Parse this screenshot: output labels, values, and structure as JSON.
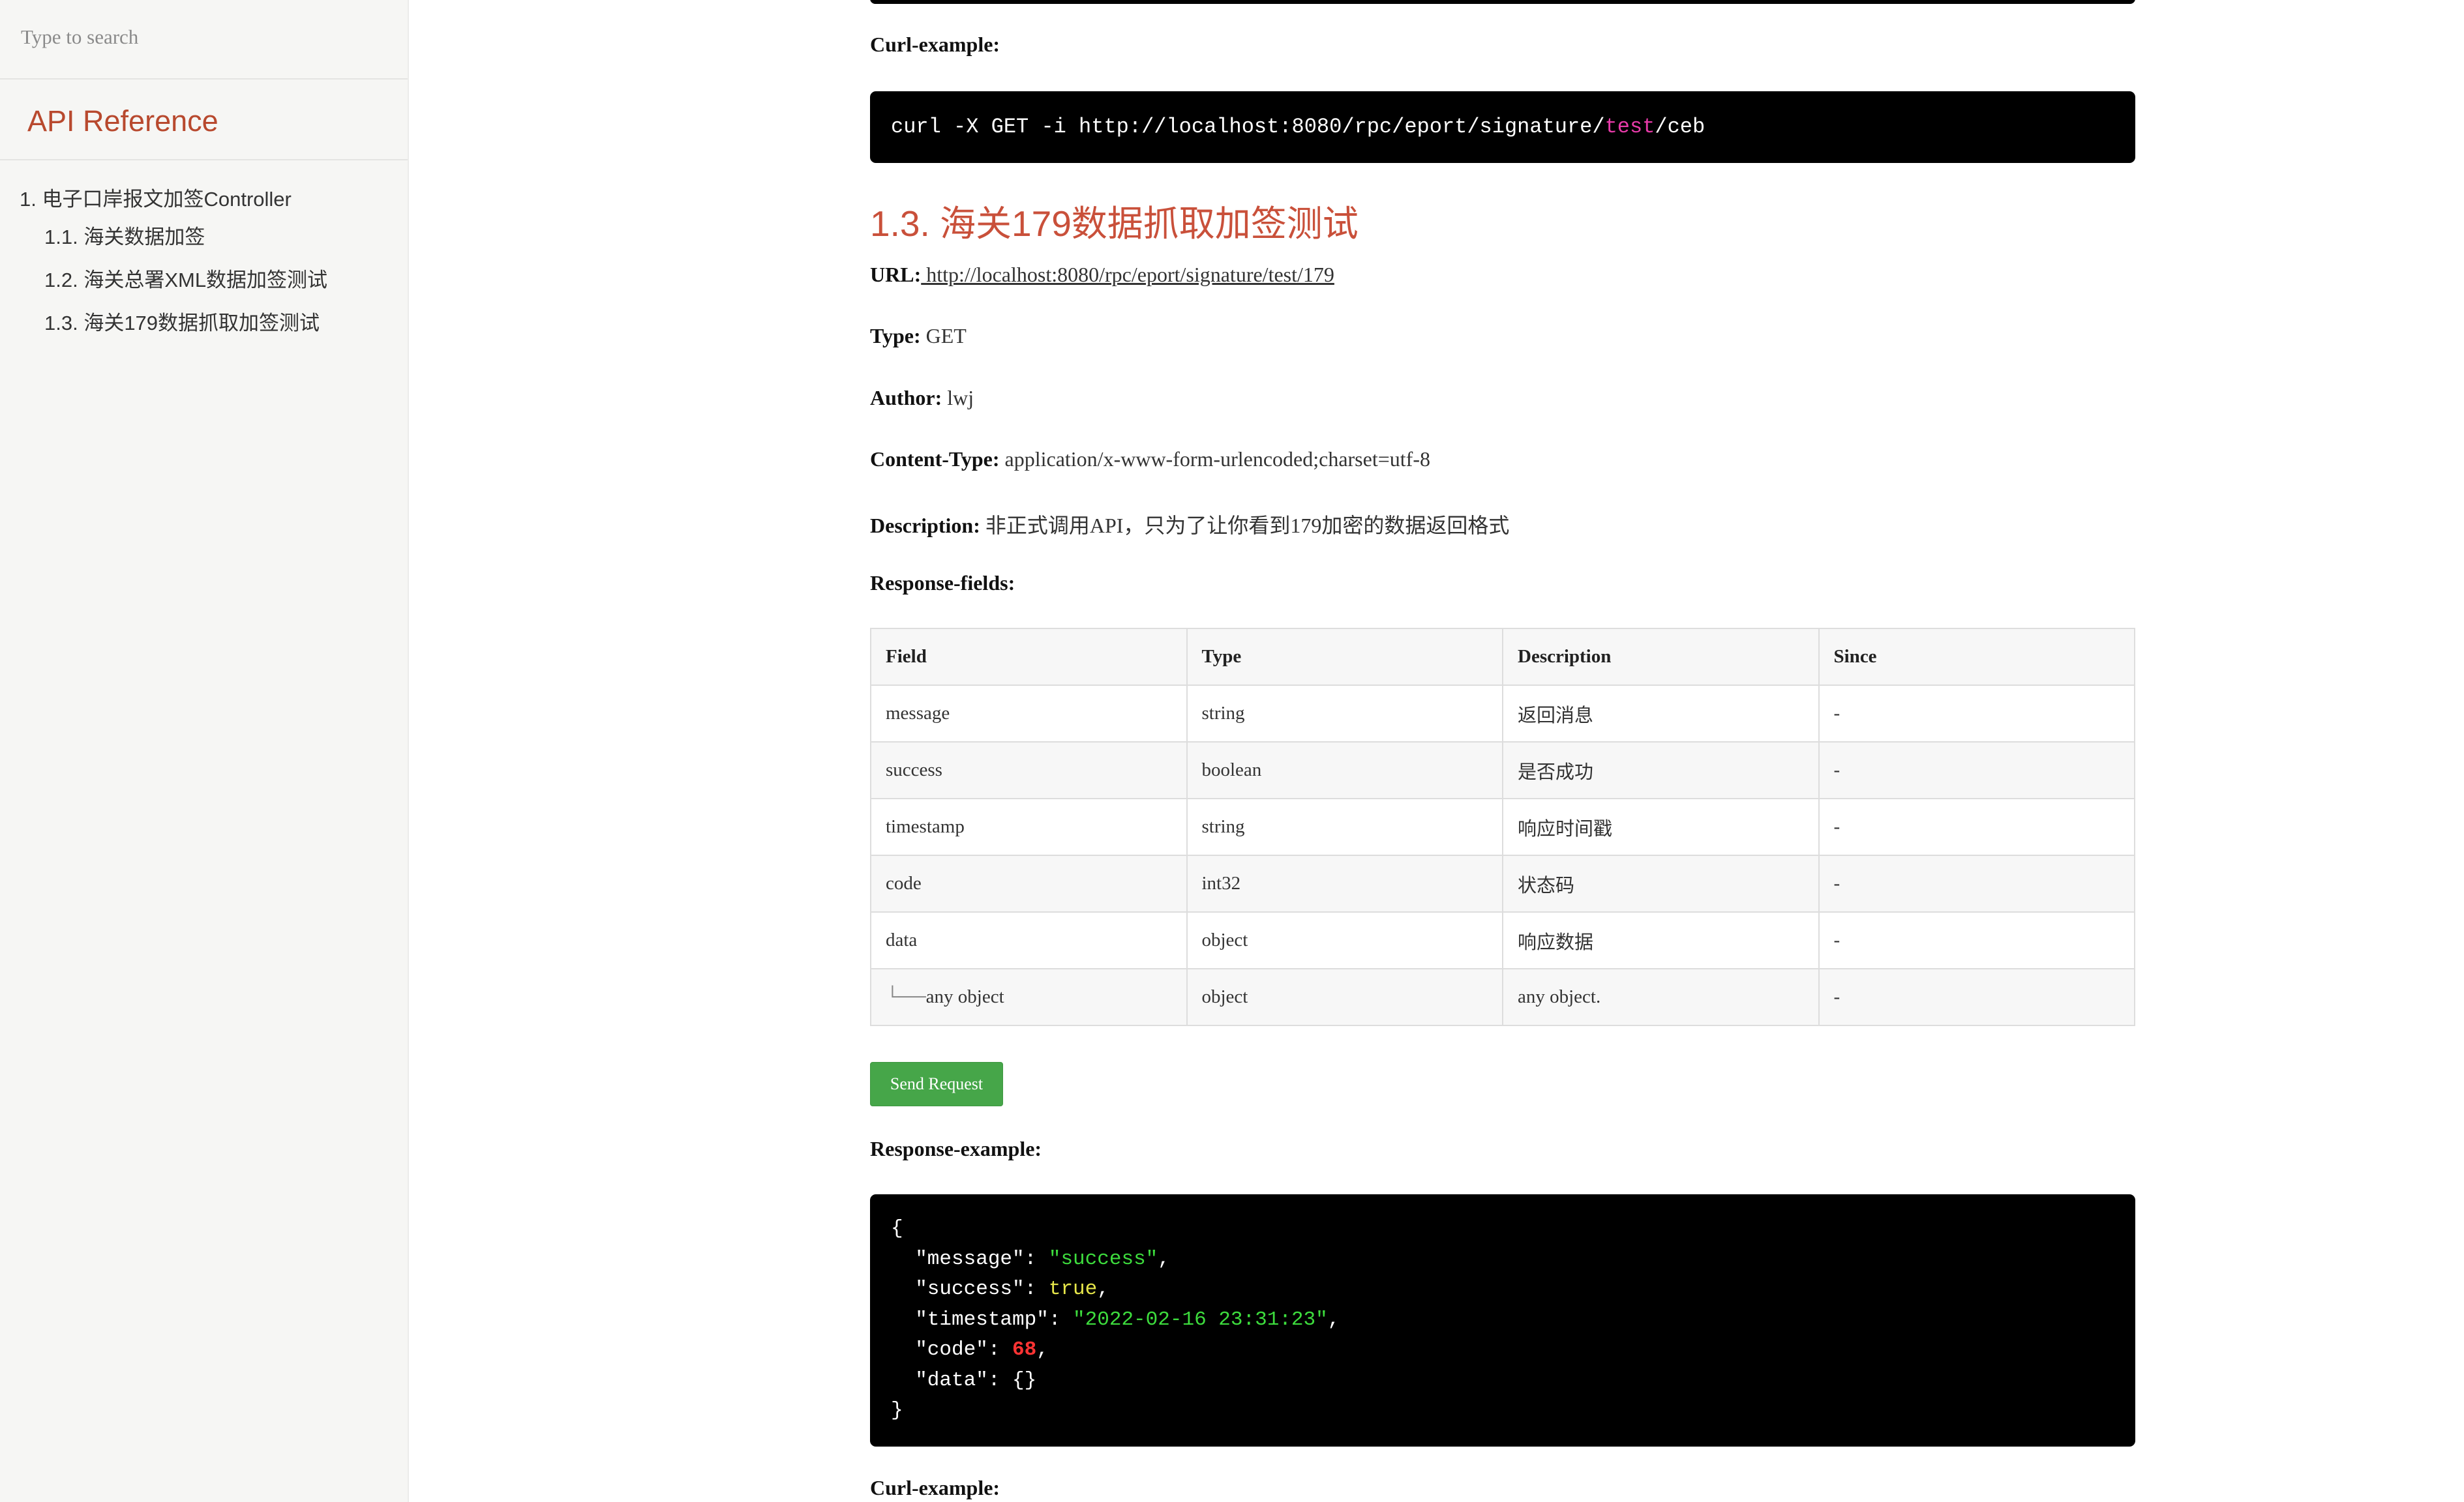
{
  "sidebar": {
    "search_placeholder": "Type to search",
    "brand": "API Reference",
    "toc": [
      {
        "label": "1. 电子口岸报文加签Controller"
      },
      {
        "label": "1.1. 海关数据加签"
      },
      {
        "label": "1.2. 海关总署XML数据加签测试"
      },
      {
        "label": "1.3. 海关179数据抓取加签测试"
      }
    ]
  },
  "main": {
    "curl_label_top": "Curl-example:",
    "curl1": {
      "prefix": "curl -X GET -i http://localhost:8080/rpc/eport/signature/",
      "highlight": "test",
      "suffix": "/ceb"
    },
    "section_title": "1.3. 海关179数据抓取加签测试",
    "url_label": "URL:",
    "url_value": " http://localhost:8080/rpc/eport/signature/test/179",
    "type_label": "Type:",
    "type_value": " GET",
    "author_label": "Author:",
    "author_value": " lwj",
    "content_type_label": "Content-Type:",
    "content_type_value": " application/x-www-form-urlencoded;charset=utf-8",
    "description_label": "Description:",
    "description_value": " 非正式调用API，只为了让你看到179加密的数据返回格式",
    "response_fields_label": "Response-fields:",
    "table": {
      "headers": [
        "Field",
        "Type",
        "Description",
        "Since"
      ],
      "rows": [
        [
          "message",
          "string",
          "返回消息",
          "-"
        ],
        [
          "success",
          "boolean",
          "是否成功",
          "-"
        ],
        [
          "timestamp",
          "string",
          "响应时间戳",
          "-"
        ],
        [
          "code",
          "int32",
          "状态码",
          "-"
        ],
        [
          "data",
          "object",
          "响应数据",
          "-"
        ],
        [
          "any object",
          "object",
          "any object.",
          "-"
        ]
      ],
      "tree_prefix": "└──"
    },
    "send_button": "Send Request",
    "response_example_label": "Response-example:",
    "response_json": {
      "open": "{",
      "k_message": "  \"message\": ",
      "v_message": "\"success\"",
      "k_success": "  \"success\": ",
      "v_success": "true",
      "k_timestamp": "  \"timestamp\": ",
      "v_timestamp": "\"2022-02-16 23:31:23\"",
      "k_code": "  \"code\": ",
      "v_code": "68",
      "k_data": "  \"data\": ",
      "v_data": "{}",
      "comma": ",",
      "close": "}"
    },
    "curl_label_bottom": "Curl-example:"
  }
}
